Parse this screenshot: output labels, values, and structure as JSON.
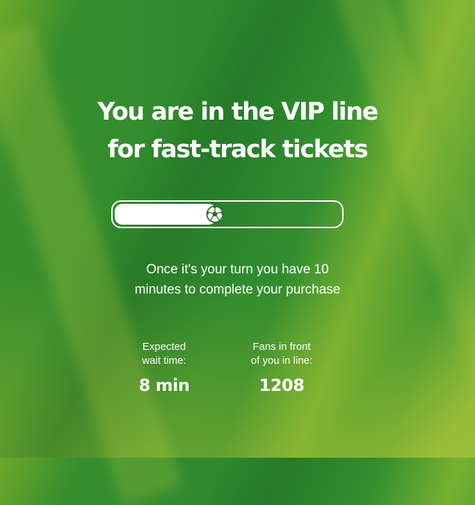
{
  "heading": {
    "line1": "You are in the VIP line",
    "line2": "for fast-track tickets"
  },
  "progress": {
    "fraction": 0.45,
    "icon": "soccer-ball-icon"
  },
  "info": {
    "line1": "Once it's your turn you have 10",
    "line2": "minutes to complete your purchase"
  },
  "stats": {
    "wait": {
      "label_line1": "Expected",
      "label_line2": "wait time:",
      "value": "8 min"
    },
    "fans": {
      "label_line1": "Fans in front",
      "label_line2": "of you in line:",
      "value": "1208"
    }
  },
  "colors": {
    "background": "#2f8a2a",
    "text": "#ffffff"
  }
}
